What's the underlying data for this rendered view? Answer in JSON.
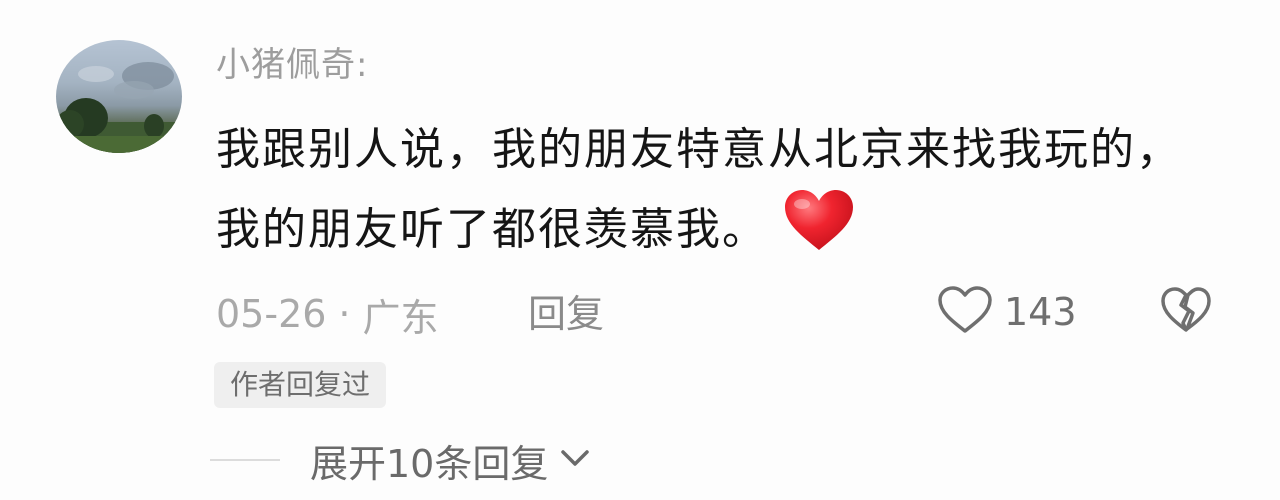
{
  "comment": {
    "username": "小猪佩奇:",
    "text": "我跟别人说，我的朋友特意从北京来找我玩的，我的朋友听了都很羡慕我。",
    "emoji": "red-heart",
    "date": "05-26",
    "separator": "·",
    "location": "广东",
    "reply_label": "回复",
    "like_count": "143",
    "author_badge": "作者回复过",
    "expand_label": "展开10条回复"
  },
  "icons": {
    "like": "heart-outline-icon",
    "dislike": "broken-heart-icon",
    "expand": "chevron-down-icon",
    "emoji": "red-heart-emoji"
  },
  "colors": {
    "username": "#9d9d9d",
    "body_text": "#151515",
    "meta": "#a9a9a9",
    "heart_emoji": "#e8202a",
    "badge_bg": "#efefef"
  }
}
